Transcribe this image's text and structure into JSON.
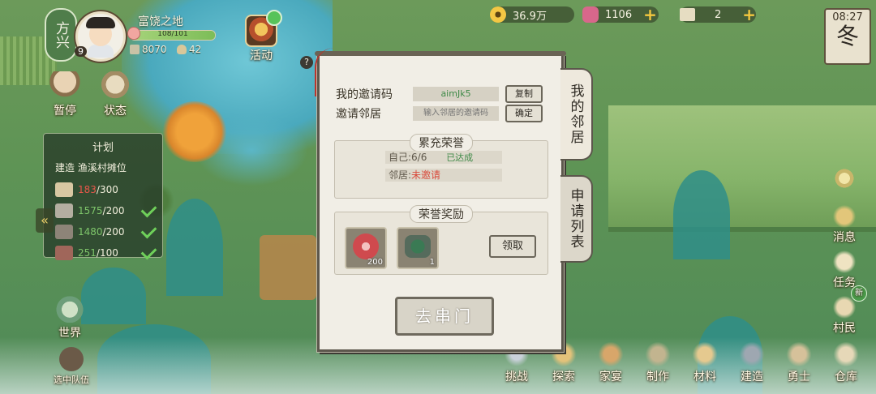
{
  "player": {
    "region": "方兴",
    "name": "富饶之地",
    "level": "9",
    "exp_text": "108/101",
    "exp_fraction": 1.0,
    "stat1": "8070",
    "stat2": "42"
  },
  "activity_label": "活动",
  "resources": {
    "coins": "36.9万",
    "gems": "1106",
    "tickets": "2"
  },
  "clock": {
    "time": "08:27",
    "season": "冬"
  },
  "left_buttons": {
    "btn1": "暂停",
    "btn2": "状态"
  },
  "plan": {
    "title": "计划",
    "subtitle": "建造 渔溪村摊位",
    "rows": [
      {
        "have": "183",
        "need": "/300",
        "status": "red"
      },
      {
        "have": "1575",
        "need": "/200",
        "status": "green"
      },
      {
        "have": "1480",
        "need": "/200",
        "status": "green"
      },
      {
        "have": "251",
        "need": "/100",
        "status": "green"
      }
    ]
  },
  "world_label": "世界",
  "team_label": "选中队伍",
  "help": "?",
  "bottom_bar": [
    "挑战",
    "探索",
    "家宴",
    "制作",
    "材料",
    "建造",
    "勇士",
    "仓库"
  ],
  "side_buttons": {
    "message": "消息",
    "task": "任务",
    "villager": "村民",
    "new_badge": "新"
  },
  "modal": {
    "my_code_label": "我的邀请码",
    "my_code": "aimJk5",
    "copy": "复制",
    "invite_label": "邀请邻居",
    "invite_placeholder": "输入邻居的邀请码",
    "confirm": "确定",
    "honor_title": "累充荣誉",
    "self_label": "自己:",
    "self_value": "6/6",
    "self_status": "已达成",
    "neighbor_label": "邻居:",
    "neighbor_status": "未邀请",
    "reward_title": "荣誉奖励",
    "reward1_count": "200",
    "reward2_count": "1",
    "claim": "领取",
    "go": "去串门"
  },
  "tabs": {
    "my_neighbors": "我的邻居",
    "request_list": "申请列表"
  },
  "colors": {
    "accent_green": "#3f8a48",
    "warn_red": "#e8574a",
    "gold": "#f3c73f"
  }
}
